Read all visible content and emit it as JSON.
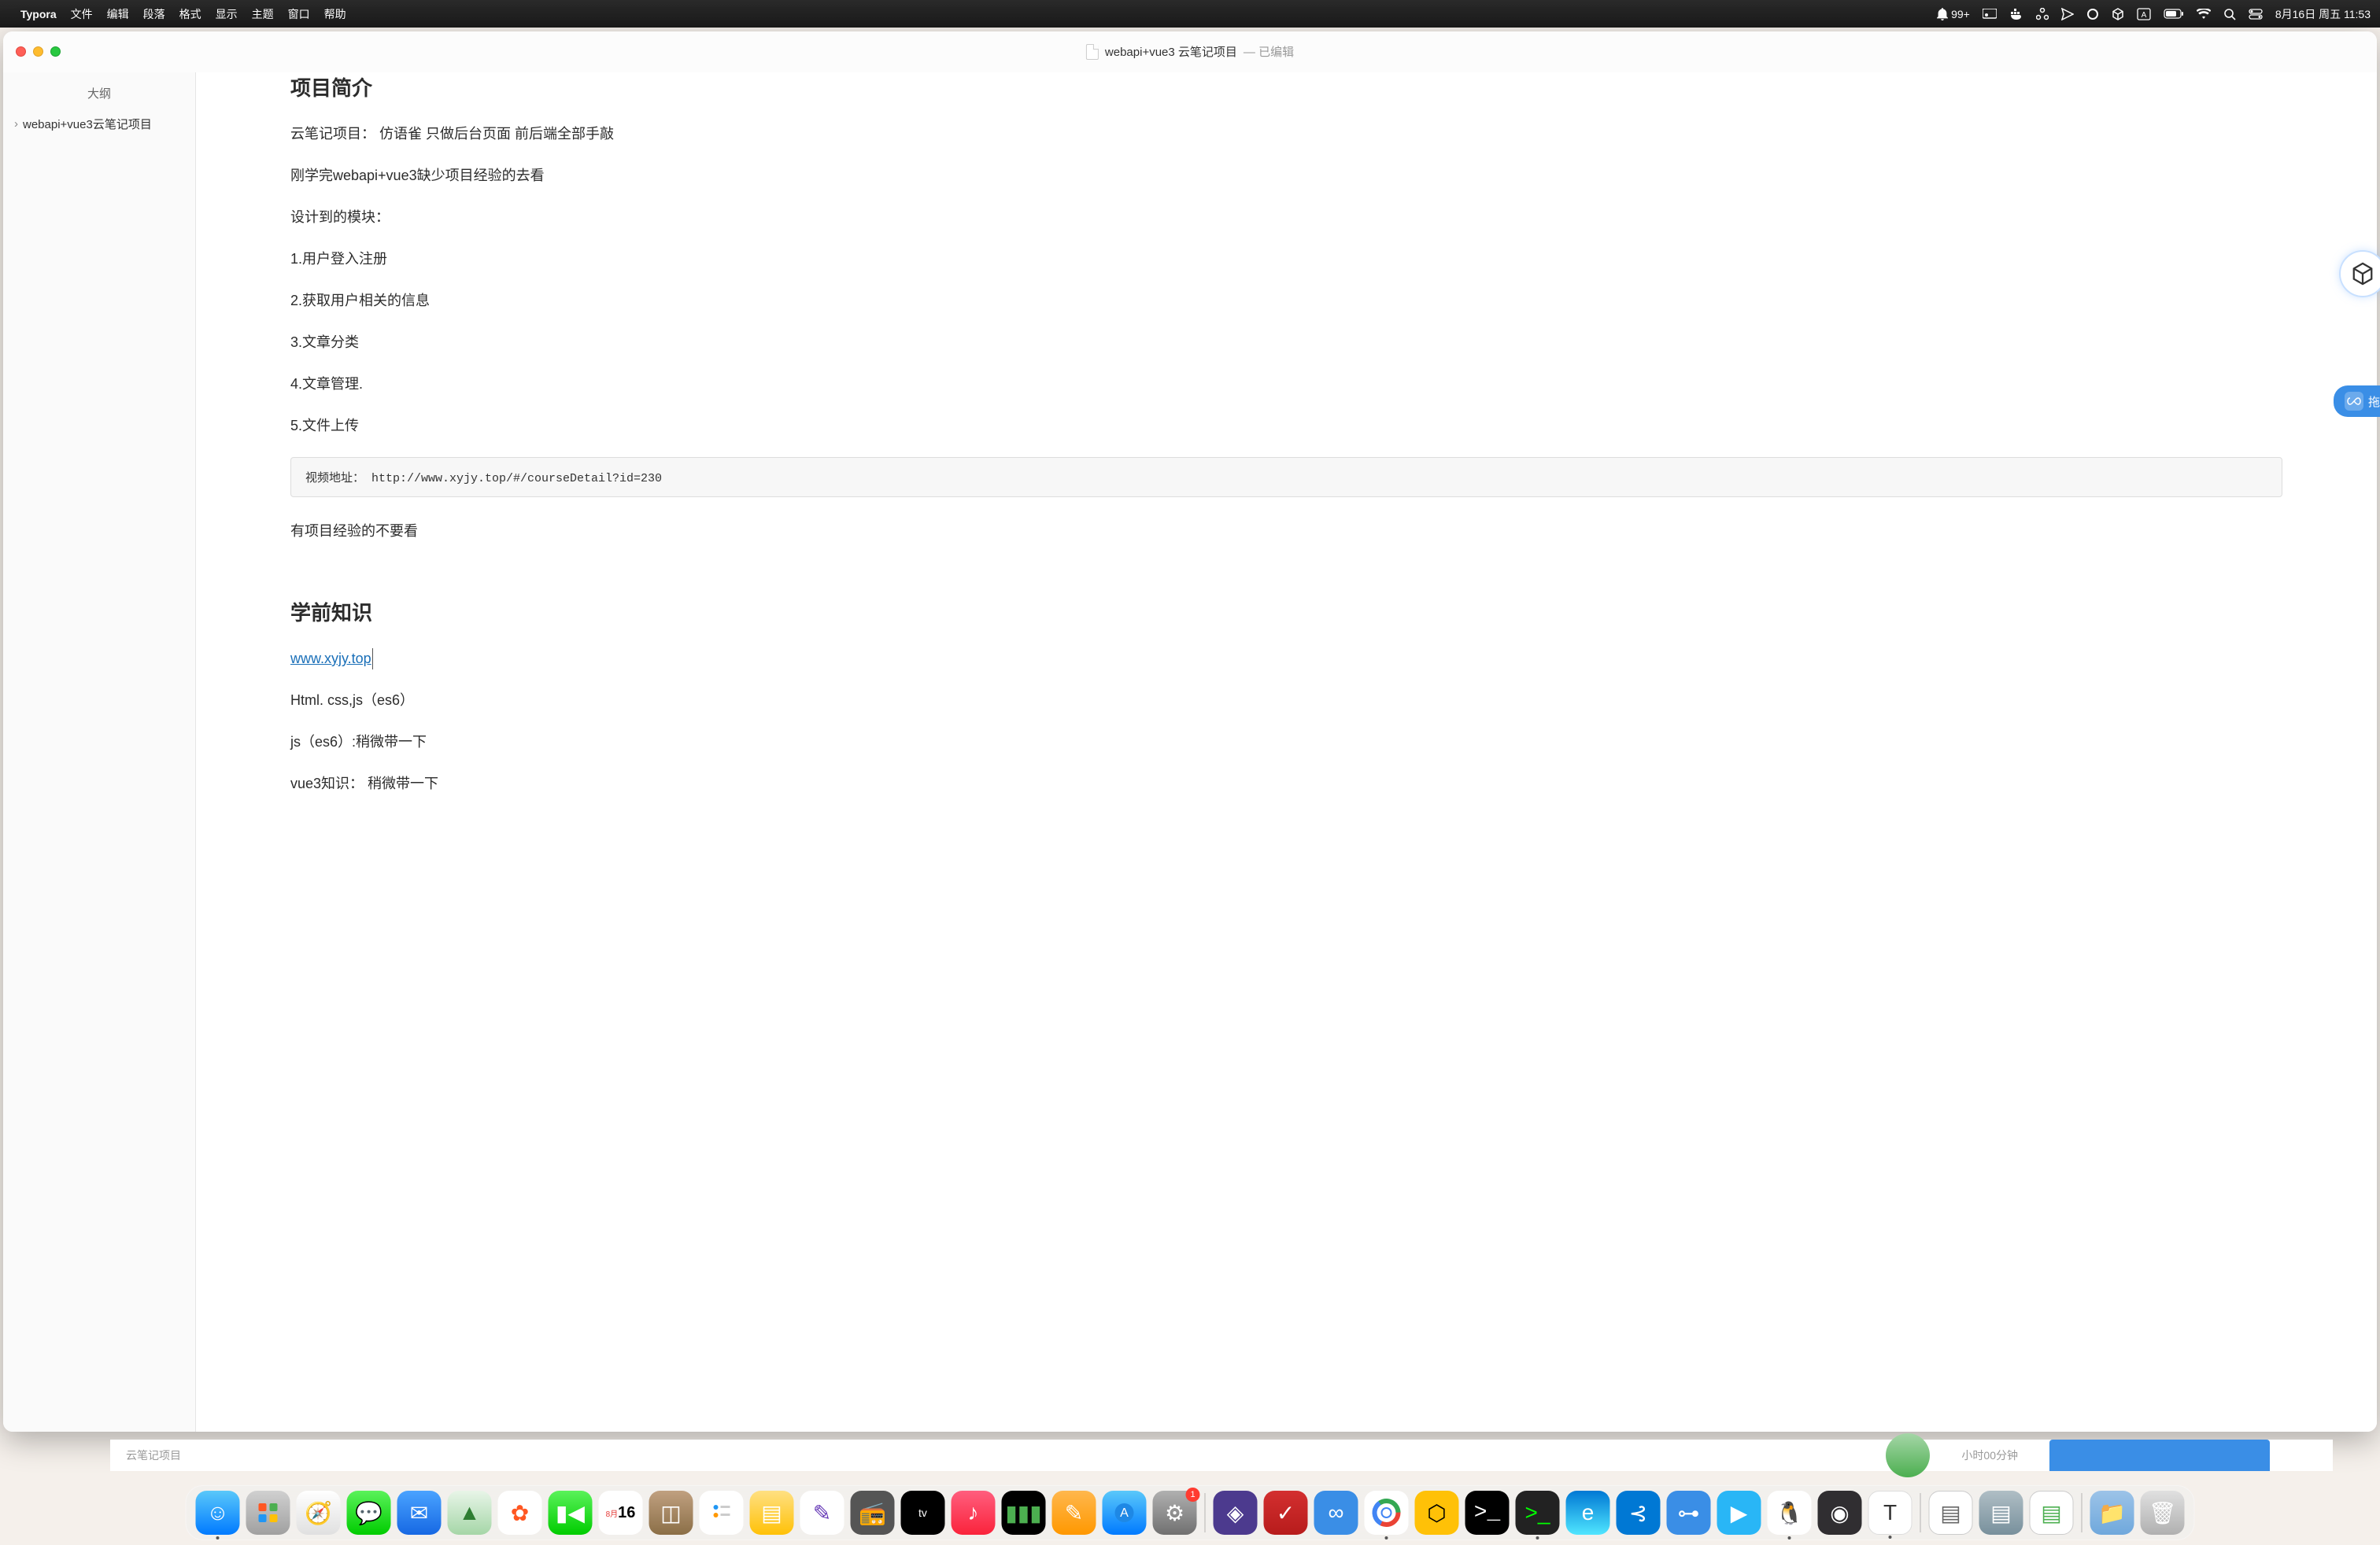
{
  "menubar": {
    "app_name": "Typora",
    "items": [
      "文件",
      "编辑",
      "段落",
      "格式",
      "显示",
      "主题",
      "窗口",
      "帮助"
    ],
    "notification_count": "99+",
    "datetime": "8月16日 周五  11:53"
  },
  "window": {
    "title": "webapi+vue3 云笔记项目",
    "edited_label": "— 已编辑"
  },
  "sidebar": {
    "title": "大纲",
    "items": [
      {
        "label": "webapi+vue3云笔记项目"
      }
    ]
  },
  "document": {
    "h1": "项目简介",
    "p1": "云笔记项目： 仿语雀   只做后台页面  前后端全部手敲",
    "p2": "刚学完webapi+vue3缺少项目经验的去看",
    "p3": "设计到的模块：",
    "p4": "1.用户登入注册",
    "p5": "2.获取用户相关的信息",
    "p6": "3.文章分类",
    "p7": "4.文章管理.",
    "p8": "5.文件上传",
    "code": "视频地址： http://www.xyjy.top/#/courseDetail?id=230",
    "p9": "有项目经验的不要看",
    "h2": "学前知识",
    "link": "www.xyjy.top",
    "p10": "Html. css,js（es6）",
    "p11": "js（es6）:稍微带一下",
    "p12": "vue3知识：  稍微带一下"
  },
  "float": {
    "tab_label": "拖"
  },
  "below": {
    "left_text": "云笔记项目",
    "timer_text": "小时00分钟"
  }
}
